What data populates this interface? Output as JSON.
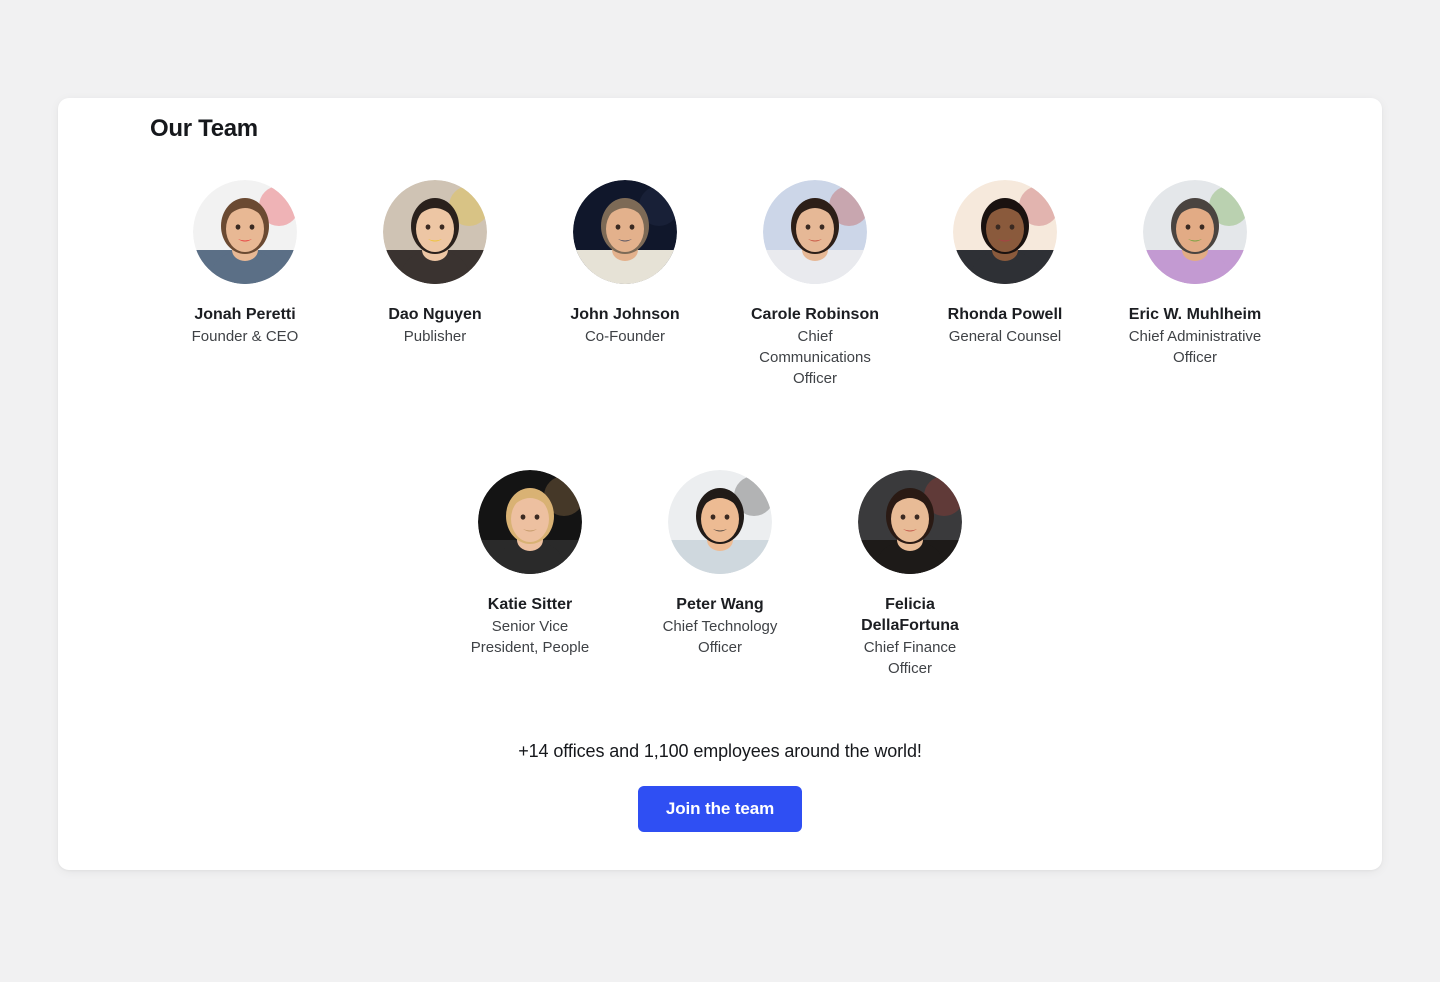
{
  "page": {
    "background_color": "#f1f1f2",
    "card_background": "#ffffff"
  },
  "section": {
    "title": "Our Team"
  },
  "team": {
    "row_primary": [
      {
        "name": "Jonah Peretti",
        "role": "Founder & CEO",
        "avatar": "avatar-jonah-peretti",
        "avatar_bg": "#f2f2f2",
        "skin": "#e8b894",
        "hair": "#6b4a32",
        "shirt": "#5b6f86",
        "accent": "#e8202a"
      },
      {
        "name": "Dao Nguyen",
        "role": "Publisher",
        "avatar": "avatar-dao-nguyen",
        "avatar_bg": "#cfc3b4",
        "skin": "#edc6a4",
        "hair": "#2a211c",
        "shirt": "#3a3330",
        "accent": "#f0c419"
      },
      {
        "name": "John Johnson",
        "role": "Co-Founder",
        "avatar": "avatar-john-johnson",
        "avatar_bg": "#10172b",
        "skin": "#e3b18c",
        "hair": "#7d6a56",
        "shirt": "#e6e2d6",
        "accent": "#2a3654"
      },
      {
        "name": "Carole Robinson",
        "role": "Chief Communications Officer",
        "avatar": "avatar-carole-robinson",
        "avatar_bg": "#ccd6e8",
        "skin": "#e6b896",
        "hair": "#2d1f18",
        "shirt": "#e9eaee",
        "accent": "#c0392b"
      },
      {
        "name": "Rhonda Powell",
        "role": "General Counsel",
        "avatar": "avatar-rhonda-powell",
        "avatar_bg": "#f6e9dc",
        "skin": "#8a5a3c",
        "hair": "#1a1210",
        "shirt": "#2e3035",
        "accent": "#b23b4a"
      },
      {
        "name": "Eric W. Muhlheim",
        "role": "Chief Administrative Officer",
        "avatar": "avatar-eric-muhlheim",
        "avatar_bg": "#e4e7ea",
        "skin": "#e2ab85",
        "hair": "#4a4440",
        "shirt": "#c39ad2",
        "accent": "#5aa02c"
      }
    ],
    "row_secondary": [
      {
        "name": "Katie Sitter",
        "role": "Senior Vice President, People",
        "avatar": "avatar-katie-sitter",
        "avatar_bg": "#141414",
        "skin": "#edc0a0",
        "hair": "#d9b274",
        "shirt": "#2a2a2a",
        "accent": "#b98f5a"
      },
      {
        "name": "Peter Wang",
        "role": "Chief Technology Officer",
        "avatar": "avatar-peter-wang",
        "avatar_bg": "#eceef0",
        "skin": "#edbb93",
        "hair": "#211b18",
        "shirt": "#cfd8de",
        "accent": "#2b2b2b"
      },
      {
        "name": "Felicia DellaFortuna",
        "role": "Chief Finance Officer",
        "avatar": "avatar-felicia-dellafortuna",
        "avatar_bg": "#3a3a3c",
        "skin": "#e8bb96",
        "hair": "#2a1a14",
        "shirt": "#1d1a18",
        "accent": "#b83b32"
      }
    ]
  },
  "footer": {
    "note": "+14 offices and 1,100 employees around the world!",
    "join_label": "Join the team",
    "join_color": "#2f4ff3"
  }
}
